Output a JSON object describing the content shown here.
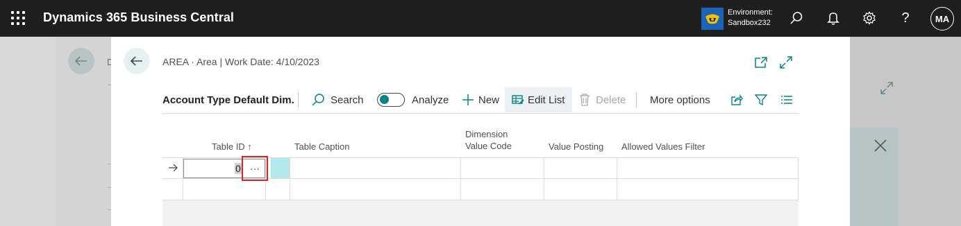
{
  "app": {
    "title": "Dynamics 365 Business Central",
    "environment_label": "Environment:",
    "environment_name": "Sandbox232",
    "avatar_initials": "MA"
  },
  "background_page": {
    "partial_letter": "D"
  },
  "modal": {
    "breadcrumb": "AREA · Area | Work Date: 4/10/2023",
    "page_title": "Account Type Default Dim.",
    "actions": {
      "search": "Search",
      "analyze": "Analyze",
      "new": "New",
      "edit_list": "Edit List",
      "delete": "Delete",
      "more_options": "More options"
    },
    "columns": {
      "table_id": "Table ID",
      "table_id_sort": "↑",
      "table_caption": "Table Caption",
      "dimension_value_code_1": "Dimension",
      "dimension_value_code_2": "Value Code",
      "value_posting": "Value Posting",
      "allowed_values_filter": "Allowed Values Filter"
    },
    "rows": [
      {
        "table_id": "0",
        "lookup": "···"
      }
    ]
  },
  "colors": {
    "topbar": "#1f1f1f",
    "accent": "#008489",
    "highlight_cell": "#b0e8ec",
    "lookup_outline": "#e02020"
  }
}
